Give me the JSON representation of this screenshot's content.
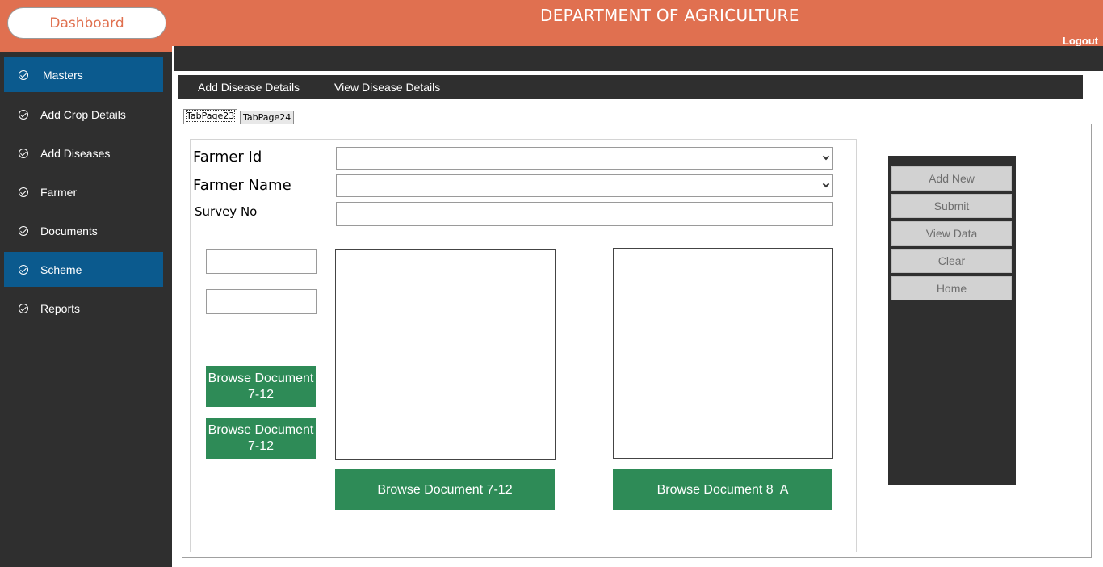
{
  "header": {
    "dashboard_label": "Dashboard",
    "title": "DEPARTMENT OF AGRICULTURE",
    "logout_label": "Logout"
  },
  "sidebar": {
    "items": [
      {
        "label": "Masters",
        "active": true
      },
      {
        "label": "Add Crop Details",
        "active": false
      },
      {
        "label": "Add Diseases",
        "active": false
      },
      {
        "label": "Farmer",
        "active": false
      },
      {
        "label": "Documents",
        "active": false
      },
      {
        "label": "Scheme",
        "active": true
      },
      {
        "label": "Reports",
        "active": false
      }
    ]
  },
  "menu": {
    "add_disease": "Add Disease Details",
    "view_disease": "View Disease Details"
  },
  "tabs": [
    {
      "label": "TabPage23",
      "selected": true
    },
    {
      "label": "TabPage24",
      "selected": false
    }
  ],
  "form": {
    "farmer_id_label": "Farmer Id",
    "farmer_id_value": "",
    "farmer_name_label": "Farmer Name",
    "farmer_name_value": "",
    "survey_no_label": "Survey No",
    "survey_no_value": "",
    "small_input_1": "",
    "small_input_2": ""
  },
  "buttons": {
    "browse_small_1": "Browse Document 7-12",
    "browse_small_2": "Browse Document 7-12",
    "browse_doc_712": "Browse Document 7-12",
    "browse_doc_8a": "Browse Document 8  A"
  },
  "actions": {
    "add_new": "Add New",
    "submit": "Submit",
    "view_data": "View Data",
    "clear": "Clear",
    "home": "Home"
  },
  "colors": {
    "header": "#e07050",
    "sidebar": "#2f2f2f",
    "active_item": "#0b5a8e",
    "green_button": "#2e8b57"
  }
}
